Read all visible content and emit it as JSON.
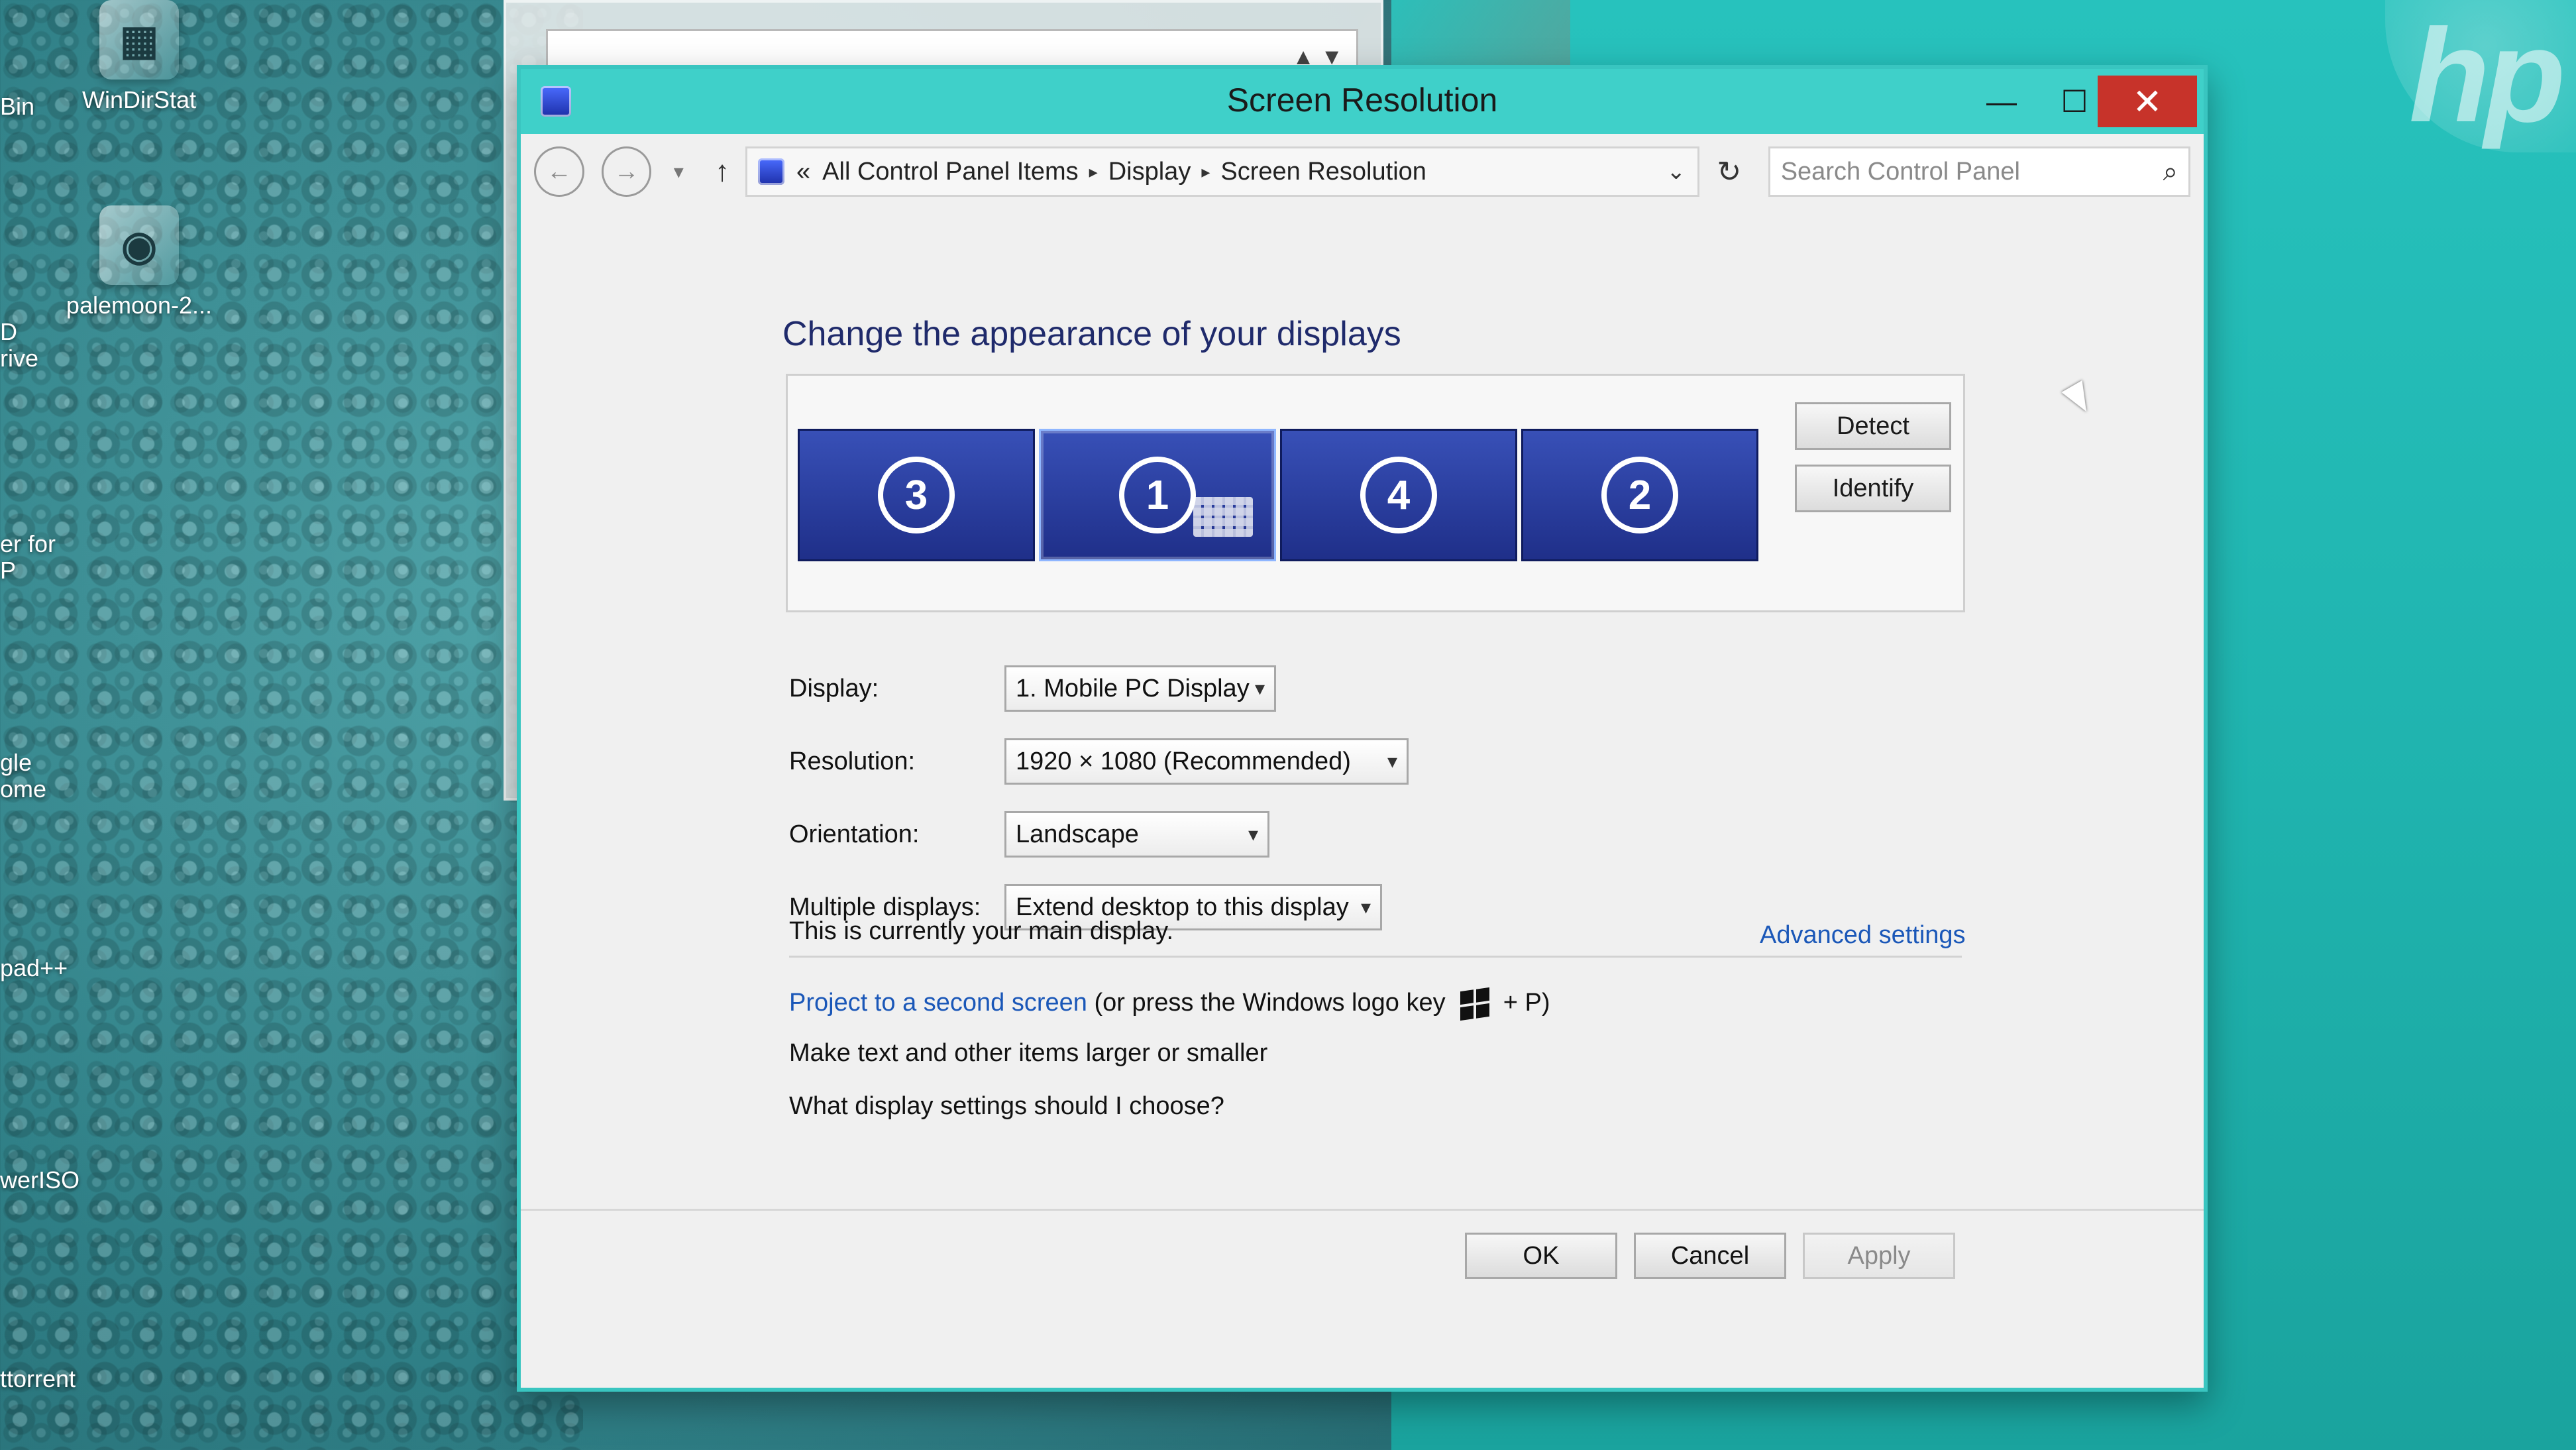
{
  "desktop": {
    "icons": [
      {
        "label": "WinDirStat",
        "glyph": "▦"
      },
      {
        "label": "palemoon-2...",
        "glyph": "◉"
      }
    ],
    "left_cut_labels": [
      "Bin",
      "D",
      "rive",
      "er for",
      "P",
      "gle",
      "ome",
      "pad++",
      "werISO",
      "ttorrent"
    ],
    "brand_text": "hp"
  },
  "window": {
    "title": "Screen Resolution",
    "controls": {
      "minimize": "—",
      "maximize": "☐",
      "close": "✕"
    }
  },
  "address_bar": {
    "back": "←",
    "forward": "→",
    "recent": "▾",
    "up": "↑",
    "prefix": "«",
    "breadcrumbs": [
      "All Control Panel Items",
      "Display",
      "Screen Resolution"
    ],
    "breadcrumb_separator": "▸",
    "dropdown": "⌄",
    "refresh": "↻",
    "search_placeholder": "Search Control Panel",
    "search_icon": "⌕"
  },
  "page": {
    "heading": "Change the appearance of your displays",
    "monitors": [
      {
        "number": "3",
        "selected": false
      },
      {
        "number": "1",
        "selected": true
      },
      {
        "number": "4",
        "selected": false
      },
      {
        "number": "2",
        "selected": false
      }
    ],
    "detect_button": "Detect",
    "identify_button": "Identify",
    "fields": {
      "display": {
        "label": "Display:",
        "value": "1. Mobile PC Display"
      },
      "resolution": {
        "label": "Resolution:",
        "value": "1920 × 1080 (Recommended)"
      },
      "orientation": {
        "label": "Orientation:",
        "value": "Landscape"
      },
      "multiple_displays": {
        "label": "Multiple displays:",
        "value": "Extend desktop to this display"
      }
    },
    "status_text": "This is currently your main display.",
    "advanced_settings": "Advanced settings",
    "project_link": "Project to a second screen",
    "project_suffix_1": "(or press the Windows logo key",
    "project_suffix_2": "+ P)",
    "text_size_link": "Make text and other items larger or smaller",
    "help_link": "What display settings should I choose?",
    "buttons": {
      "ok": "OK",
      "cancel": "Cancel",
      "apply": "Apply"
    }
  },
  "colors": {
    "title_bar": "#3fd0c9",
    "close_button": "#c7332a",
    "link": "#1a57b8",
    "monitor_fill": "#2b3fa0"
  }
}
